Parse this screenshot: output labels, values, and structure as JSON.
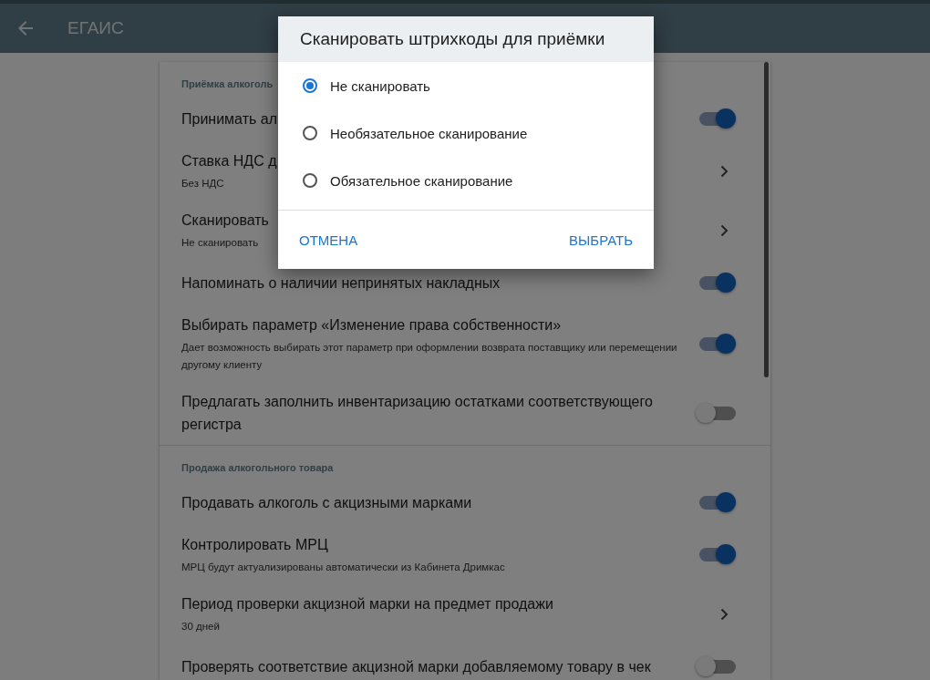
{
  "header": {
    "title": "ЕГАИС"
  },
  "sections": [
    {
      "title": "Приёмка алкоголь",
      "items": [
        {
          "kind": "toggle",
          "label": "Принимать ал",
          "on": true
        },
        {
          "kind": "nav",
          "label": "Ставка НДС д",
          "sub": "Без НДС"
        },
        {
          "kind": "nav",
          "label": "Сканировать",
          "sub": "Не сканировать"
        },
        {
          "kind": "toggle",
          "label": "Напоминать о наличии непринятых накладных",
          "on": true
        },
        {
          "kind": "toggle",
          "label": "Выбирать параметр «Изменение права собственности»",
          "sub": "Дает возможность выбирать этот параметр при оформлении возврата поставщику или перемещении другому клиенту",
          "on": true
        },
        {
          "kind": "toggle",
          "label": "Предлагать заполнить инвентаризацию остатками соответствующего регистра",
          "on": false
        }
      ]
    },
    {
      "title": "Продажа алкогольного товара",
      "items": [
        {
          "kind": "toggle",
          "label": "Продавать алкоголь с акцизными марками",
          "on": true
        },
        {
          "kind": "toggle",
          "label": "Контролировать МРЦ",
          "sub": "МРЦ будут актуализированы автоматически из Кабинета Дримкас",
          "on": true
        },
        {
          "kind": "nav",
          "label": "Период проверки акцизной марки на предмет продажи",
          "sub": "30 дней"
        },
        {
          "kind": "toggle",
          "label": "Проверять соответствие акцизной марки добавляемому товару в чек",
          "on": false
        }
      ]
    }
  ],
  "dialog": {
    "title": "Сканировать штрихкоды для приёмки",
    "options": [
      {
        "label": "Не сканировать",
        "selected": true
      },
      {
        "label": "Необязательное сканирование",
        "selected": false
      },
      {
        "label": "Обязательное сканирование",
        "selected": false
      }
    ],
    "buttons": [
      "ОТМЕНА",
      "ВЫБРАТЬ"
    ]
  }
}
